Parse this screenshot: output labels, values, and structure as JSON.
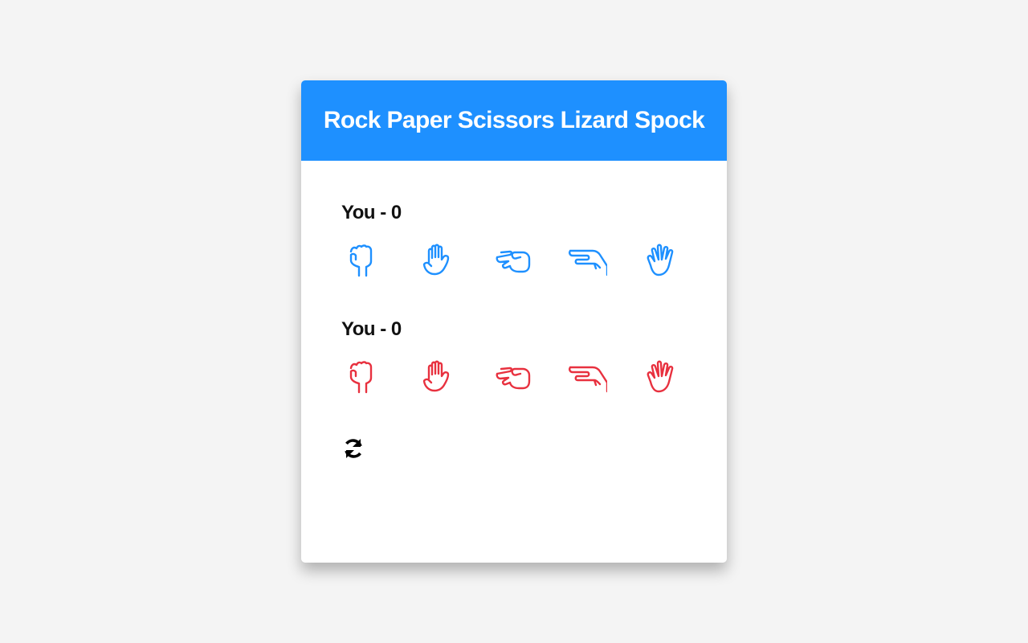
{
  "app": {
    "title": "Rock Paper Scissors Lizard Spock"
  },
  "players": [
    {
      "label": "You - 0",
      "color": "#1e90ff",
      "hands": [
        {
          "name": "rock",
          "icon": "hand-rock-icon"
        },
        {
          "name": "paper",
          "icon": "hand-paper-icon"
        },
        {
          "name": "scissors",
          "icon": "hand-scissors-icon"
        },
        {
          "name": "lizard",
          "icon": "hand-lizard-icon"
        },
        {
          "name": "spock",
          "icon": "hand-spock-icon"
        }
      ]
    },
    {
      "label": "You - 0",
      "color": "#e8313f",
      "hands": [
        {
          "name": "rock",
          "icon": "hand-rock-icon"
        },
        {
          "name": "paper",
          "icon": "hand-paper-icon"
        },
        {
          "name": "scissors",
          "icon": "hand-scissors-icon"
        },
        {
          "name": "lizard",
          "icon": "hand-lizard-icon"
        },
        {
          "name": "spock",
          "icon": "hand-spock-icon"
        }
      ]
    }
  ],
  "reset": {
    "icon": "refresh-icon"
  },
  "colors": {
    "header": "#1e90ff",
    "player_one": "#1e90ff",
    "player_two": "#e8313f",
    "background": "#f4f4f4"
  }
}
